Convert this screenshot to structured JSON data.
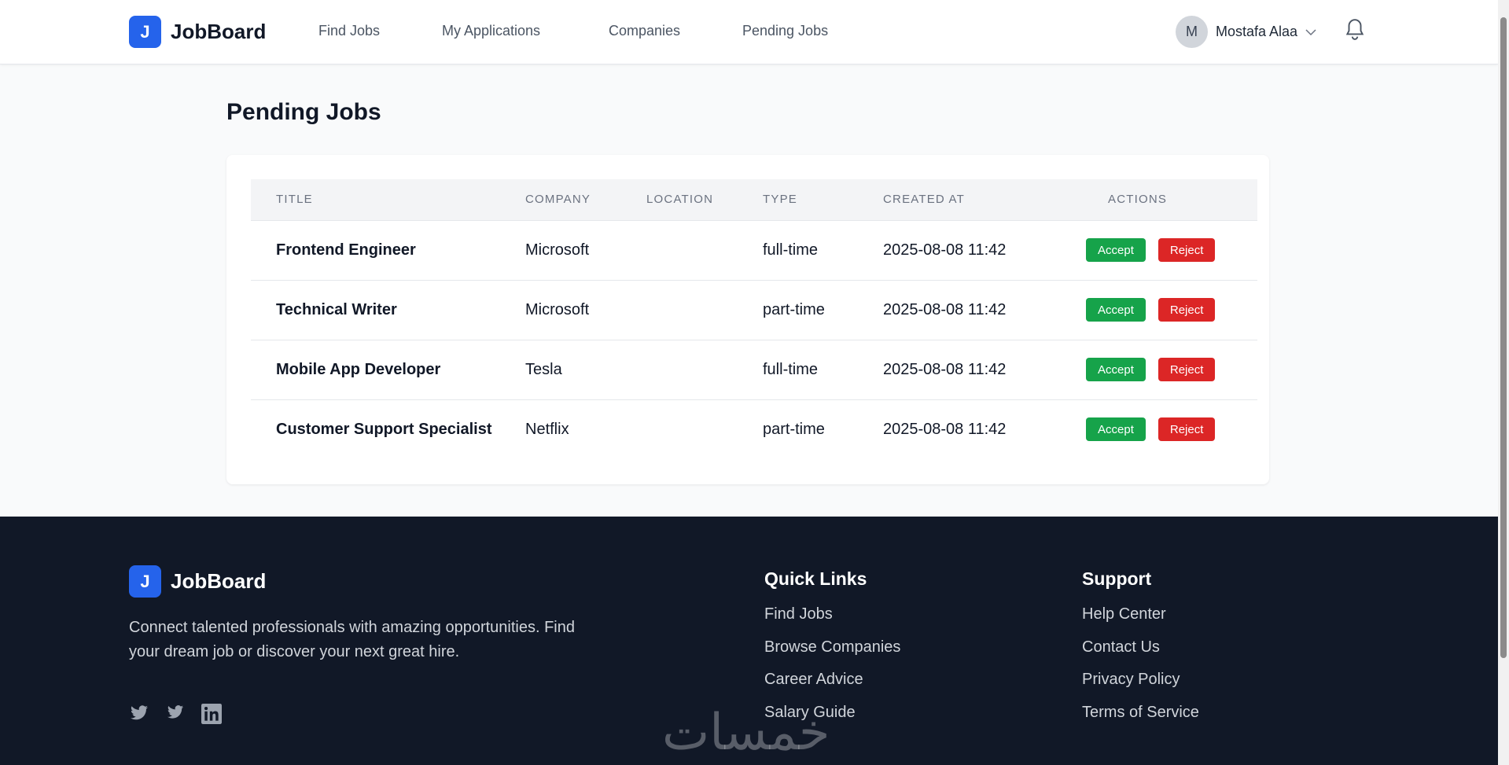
{
  "brand": {
    "mark": "J",
    "name": "JobBoard"
  },
  "nav": [
    "Find Jobs",
    "My Applications",
    "Companies",
    "Pending Jobs"
  ],
  "user": {
    "initial": "M",
    "name": "Mostafa Alaa"
  },
  "page_title": "Pending Jobs",
  "table": {
    "headers": [
      "Title",
      "Company",
      "Location",
      "Type",
      "Created At",
      "Actions"
    ],
    "rows": [
      {
        "title": "Frontend Engineer",
        "company": "Microsoft",
        "location": "",
        "type": "full-time",
        "created": "2025-08-08 11:42"
      },
      {
        "title": "Technical Writer",
        "company": "Microsoft",
        "location": "",
        "type": "part-time",
        "created": "2025-08-08 11:42"
      },
      {
        "title": "Mobile App Developer",
        "company": "Tesla",
        "location": "",
        "type": "full-time",
        "created": "2025-08-08 11:42"
      },
      {
        "title": "Customer Support Specialist",
        "company": "Netflix",
        "location": "",
        "type": "part-time",
        "created": "2025-08-08 11:42"
      }
    ],
    "accept_label": "Accept",
    "reject_label": "Reject"
  },
  "footer": {
    "description": "Connect talented professionals with amazing opportunities. Find your dream job or discover your next great hire.",
    "social": [
      "twitter-icon",
      "twitter-icon",
      "linkedin-icon"
    ],
    "quick_links": {
      "title": "Quick Links",
      "items": [
        "Find Jobs",
        "Browse Companies",
        "Career Advice",
        "Salary Guide"
      ]
    },
    "support": {
      "title": "Support",
      "items": [
        "Help Center",
        "Contact Us",
        "Privacy Policy",
        "Terms of Service"
      ]
    },
    "watermark": "خمسات"
  },
  "colors": {
    "primary": "#2563eb",
    "accept": "#16a34a",
    "reject": "#dc2626",
    "footer_bg": "#111827"
  }
}
